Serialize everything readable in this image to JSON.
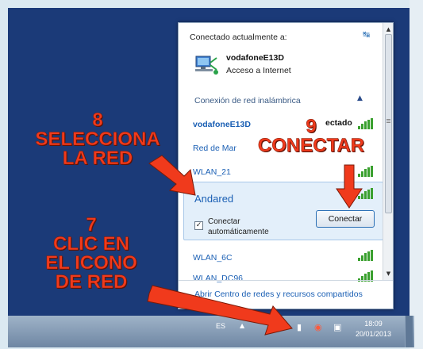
{
  "flyout": {
    "header": "Conectado actualmente a:",
    "current_network": {
      "name": "vodafoneE13D",
      "status": "Acceso a Internet"
    },
    "section_header": "Conexión de red inalámbrica",
    "networks": [
      {
        "name": "vodafoneE13D",
        "status": "ectado"
      },
      {
        "name": "Red de Mar"
      },
      {
        "name": "WLAN_21"
      },
      {
        "name": "Andared",
        "selected": true
      },
      {
        "name": "WLAN_6C"
      },
      {
        "name": "WLAN_DC96"
      }
    ],
    "auto_connect_label": "Conectar automáticamente",
    "auto_connect_checked": true,
    "connect_button": "Conectar",
    "footer_link": "Abrir Centro de redes y recursos compartidos"
  },
  "taskbar": {
    "language": "ES",
    "time": "18:09",
    "date": "20/01/2013"
  },
  "annotations": {
    "step8": {
      "number": "8",
      "lines": [
        "SELECCIONA",
        "LA RED"
      ]
    },
    "step9": {
      "number": "9",
      "text": "CONECTAR"
    },
    "step7": {
      "number": "7",
      "lines": [
        "CLIC EN",
        "EL ICONO",
        "DE RED"
      ]
    }
  },
  "colors": {
    "desktop": "#1b3a78",
    "annotation": "#f03a1c",
    "link": "#1a5fb4",
    "signal": "#3aa02f"
  },
  "icons": [
    "refresh-icon",
    "network-computer-icon",
    "collapse-chevron-icon",
    "signal-bars-icon",
    "checkbox-icon",
    "scroll-up-icon",
    "scroll-down-icon",
    "flag-icon",
    "volume-icon",
    "network-tray-icon"
  ]
}
